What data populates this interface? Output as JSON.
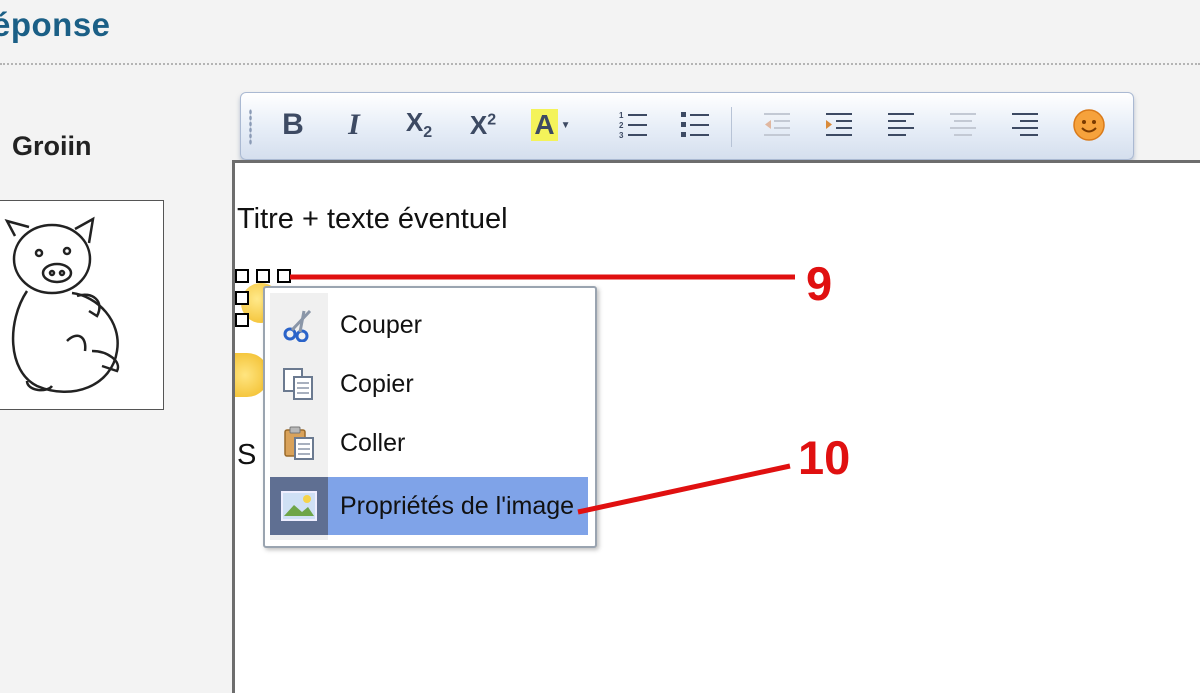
{
  "header": {
    "title": "éponse"
  },
  "user": {
    "name": "Groiin"
  },
  "toolbar": {
    "buttons": [
      {
        "name": "bold-button",
        "icon": "bold-icon",
        "label": "B"
      },
      {
        "name": "italic-button",
        "icon": "italic-icon",
        "label": "I"
      },
      {
        "name": "subscript-button",
        "icon": "subscript-icon",
        "label": "X2"
      },
      {
        "name": "superscript-button",
        "icon": "superscript-icon",
        "label": "X2"
      },
      {
        "name": "text-color-button",
        "icon": "text-color-icon",
        "label": "A"
      },
      {
        "name": "ordered-list-button",
        "icon": "numbered-list-icon"
      },
      {
        "name": "bullet-list-button",
        "icon": "bullet-list-icon"
      },
      {
        "name": "outdent-button",
        "icon": "outdent-icon"
      },
      {
        "name": "indent-button",
        "icon": "indent-icon"
      },
      {
        "name": "align-left-button",
        "icon": "align-left-icon"
      },
      {
        "name": "align-center-button",
        "icon": "align-center-icon"
      },
      {
        "name": "align-right-button",
        "icon": "align-right-icon"
      },
      {
        "name": "emoticon-button",
        "icon": "smiley-icon"
      }
    ]
  },
  "editor": {
    "line1": "Titre + texte éventuel",
    "line_partial": "S"
  },
  "context_menu": {
    "items": [
      {
        "label": "Couper",
        "icon": "scissors-icon"
      },
      {
        "label": "Copier",
        "icon": "copy-icon"
      },
      {
        "label": "Coller",
        "icon": "paste-icon"
      },
      {
        "label": "Propriétés de l'image",
        "icon": "image-icon",
        "highlighted": true
      }
    ]
  },
  "annotations": {
    "first": "9",
    "second": "10"
  },
  "colors": {
    "title": "#1b5f86",
    "annotation": "#e01010",
    "menu_highlight": "#7fa3e8"
  }
}
